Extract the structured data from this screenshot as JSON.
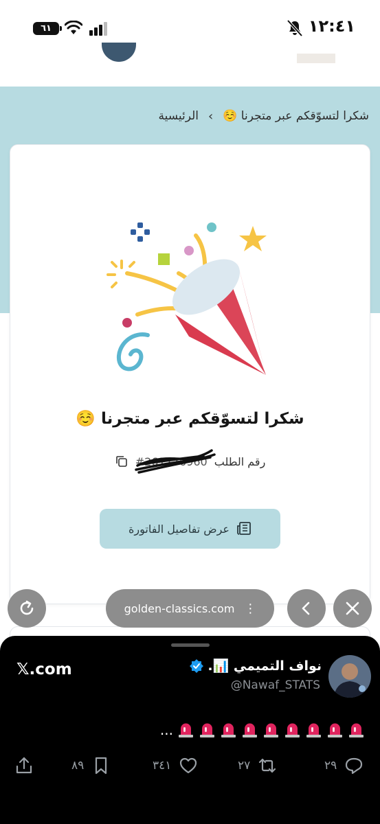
{
  "status_bar": {
    "time": "١٢:٤١",
    "battery": "٦١"
  },
  "breadcrumb": {
    "home": "الرئيسية",
    "separator": "›",
    "current": "شكرا لتسوّقكم عبر متجرنا ☺️"
  },
  "confirmation": {
    "title": "شكرا لتسوّقكم عبر متجرنا ☺️",
    "order_label": "رقم الطلب",
    "order_number": "#261776960",
    "invoice_button": "عرض تفاصيل الفاتورة"
  },
  "browser": {
    "url": "golden-classics.com"
  },
  "tweet": {
    "site": "𝕏.com",
    "name": "نواف التميمي 📊.",
    "handle": "@Nawaf_STATS",
    "text_suffix": "...",
    "siren_count": 9,
    "replies": "٢٩",
    "retweets": "٢٧",
    "likes": "٣٤١",
    "bookmarks": "٨٩"
  },
  "colors": {
    "banner": "#b7dbe1",
    "sheet": "#000000",
    "browser_controls": "#8d8d8d",
    "siren": "#e0245e"
  }
}
